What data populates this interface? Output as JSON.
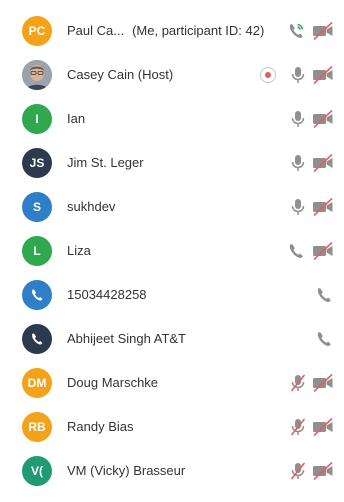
{
  "participants": [
    {
      "initials": "PC",
      "avatar_color": "#f5a21b",
      "name": "Paul Ca...",
      "suffix": "(Me, participant ID: 42)",
      "audio": "phone-active"
    },
    {
      "initials": "",
      "avatar_color": "#7d8a94",
      "name": "Casey Cain (Host)",
      "suffix": "",
      "audio": "mic",
      "recording": true
    },
    {
      "initials": "I",
      "avatar_color": "#2fa84f",
      "name": "Ian",
      "suffix": "",
      "audio": "mic"
    },
    {
      "initials": "JS",
      "avatar_color": "#2c3a4d",
      "name": "Jim St. Leger",
      "suffix": "",
      "audio": "mic"
    },
    {
      "initials": "S",
      "avatar_color": "#2f7fc8",
      "name": "sukhdev",
      "suffix": "",
      "audio": "mic"
    },
    {
      "initials": "L",
      "avatar_color": "#2fa84f",
      "name": "Liza",
      "suffix": "",
      "audio": "phone"
    },
    {
      "initials": "",
      "avatar_color": "#2f7fc8",
      "name": "15034428258",
      "suffix": "",
      "audio": "phone-only"
    },
    {
      "initials": "",
      "avatar_color": "#2c3a4d",
      "name": "Abhijeet Singh AT&T",
      "suffix": "",
      "audio": "phone-only"
    },
    {
      "initials": "DM",
      "avatar_color": "#f5a21b",
      "name": "Doug Marschke",
      "suffix": "",
      "audio": "mic-muted"
    },
    {
      "initials": "RB",
      "avatar_color": "#f5a21b",
      "name": "Randy Bias",
      "suffix": "",
      "audio": "mic-muted"
    },
    {
      "initials": "V(",
      "avatar_color": "#1f9a72",
      "name": "VM (Vicky) Brasseur",
      "suffix": "",
      "audio": "mic-muted"
    }
  ],
  "colors": {
    "icon_gray": "#8f8f8f",
    "mute_red": "#e06060",
    "phone_green": "#3aa85a"
  },
  "icons": {
    "phone": "phone-icon",
    "mic": "microphone-icon",
    "video_off": "video-off-icon",
    "recording": "recording-icon",
    "photo": "user-photo"
  }
}
